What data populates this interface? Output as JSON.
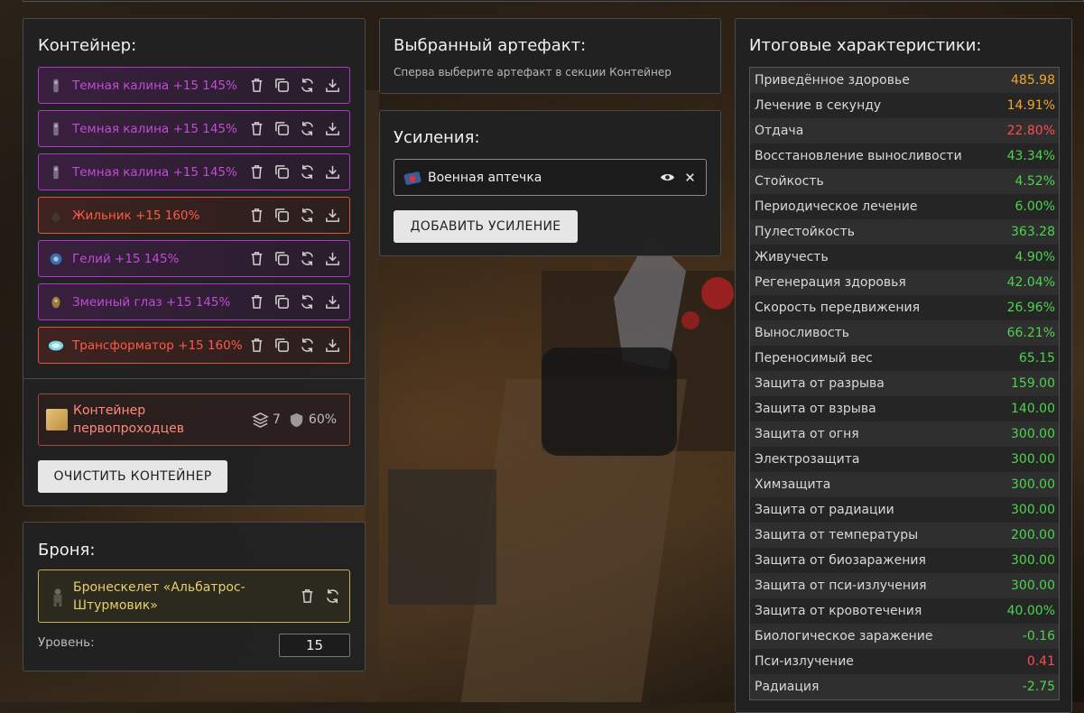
{
  "container": {
    "title": "Контейнер:",
    "slots": [
      {
        "name": "Темная калина +15 145%",
        "tier": "purple",
        "icon": "kalina-artifact-icon"
      },
      {
        "name": "Темная калина +15 145%",
        "tier": "purple",
        "icon": "kalina-artifact-icon"
      },
      {
        "name": "Темная калина +15 145%",
        "tier": "purple",
        "icon": "kalina-artifact-icon"
      },
      {
        "name": "Жильник +15 160%",
        "tier": "red",
        "icon": "zhilnik-artifact-icon"
      },
      {
        "name": "Гелий +15 145%",
        "tier": "purple",
        "icon": "helium-artifact-icon"
      },
      {
        "name": "Змеиный глаз +15 145%",
        "tier": "purple",
        "icon": "snake-eye-artifact-icon"
      },
      {
        "name": "Трансформатор +15 160%",
        "tier": "red",
        "icon": "transformer-artifact-icon"
      }
    ],
    "card": {
      "name": "Контейнер первопроходцев",
      "slots_count": "7",
      "protection": "60%"
    },
    "clear_label": "ОЧИСТИТЬ КОНТЕЙНЕР"
  },
  "armor": {
    "title": "Броня:",
    "name": "Бронескелет «Альбатрос-Штурмовик»",
    "level_label": "Уровень:",
    "level_value": "15"
  },
  "selected": {
    "title": "Выбранный артефакт:",
    "hint": "Сперва выберите артефакт в секции Контейнер"
  },
  "boosts": {
    "title": "Усиления:",
    "item": "Военная аптечка",
    "add_label": "ДОБАВИТЬ УСИЛЕНИЕ"
  },
  "stats": {
    "title": "Итоговые характеристики:",
    "rows": [
      {
        "label": "Приведённое здоровье",
        "value": "485.98",
        "color": "orange"
      },
      {
        "label": "Лечение в секунду",
        "value": "14.91%",
        "color": "orange"
      },
      {
        "label": "Отдача",
        "value": "22.80%",
        "color": "red"
      },
      {
        "label": "Восстановление выносливости",
        "value": "43.34%",
        "color": "green"
      },
      {
        "label": "Стойкость",
        "value": "4.52%",
        "color": "green"
      },
      {
        "label": "Периодическое лечение",
        "value": "6.00%",
        "color": "green"
      },
      {
        "label": "Пулестойкость",
        "value": "363.28",
        "color": "green"
      },
      {
        "label": "Живучесть",
        "value": "4.90%",
        "color": "green"
      },
      {
        "label": "Регенерация здоровья",
        "value": "42.04%",
        "color": "green"
      },
      {
        "label": "Скорость передвижения",
        "value": "26.96%",
        "color": "green"
      },
      {
        "label": "Выносливость",
        "value": "66.21%",
        "color": "green"
      },
      {
        "label": "Переносимый вес",
        "value": "65.15",
        "color": "green"
      },
      {
        "label": "Защита от разрыва",
        "value": "159.00",
        "color": "green"
      },
      {
        "label": "Защита от взрыва",
        "value": "140.00",
        "color": "green"
      },
      {
        "label": "Защита от огня",
        "value": "300.00",
        "color": "green"
      },
      {
        "label": "Электрозащита",
        "value": "300.00",
        "color": "green"
      },
      {
        "label": "Химзащита",
        "value": "300.00",
        "color": "green"
      },
      {
        "label": "Защита от радиации",
        "value": "300.00",
        "color": "green"
      },
      {
        "label": "Защита от температуры",
        "value": "200.00",
        "color": "green"
      },
      {
        "label": "Защита от биозаражения",
        "value": "300.00",
        "color": "green"
      },
      {
        "label": "Защита от пси-излучения",
        "value": "300.00",
        "color": "green"
      },
      {
        "label": "Защита от кровотечения",
        "value": "40.00%",
        "color": "green"
      },
      {
        "label": "Биологическое заражение",
        "value": "-0.16",
        "color": "green"
      },
      {
        "label": "Пси-излучение",
        "value": "0.41",
        "color": "red"
      },
      {
        "label": "Радиация",
        "value": "-2.75",
        "color": "green"
      }
    ]
  },
  "colors": {
    "purple": "#c34ad8",
    "red": "#ff5a44",
    "green": "#4cd44c",
    "orange": "#f2a626",
    "gold": "#e9cf6a"
  }
}
